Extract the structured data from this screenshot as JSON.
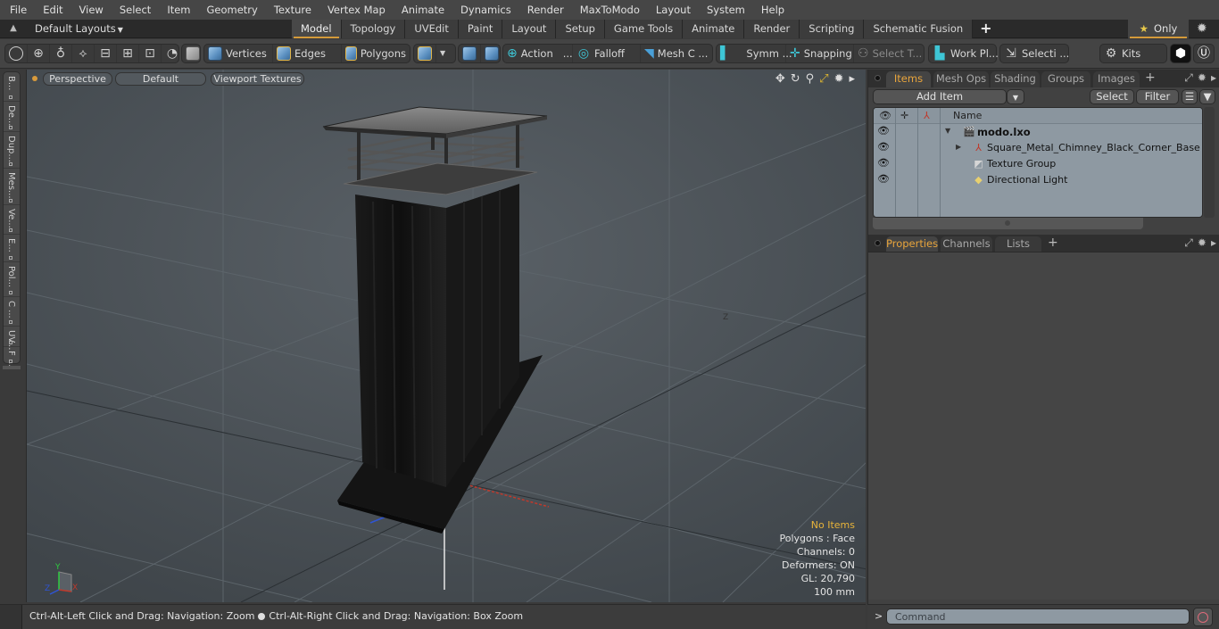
{
  "menu": [
    "File",
    "Edit",
    "View",
    "Select",
    "Item",
    "Geometry",
    "Texture",
    "Vertex Map",
    "Animate",
    "Dynamics",
    "Render",
    "MaxToModo",
    "Layout",
    "System",
    "Help"
  ],
  "layout_bar": {
    "layouts_label": "Default Layouts",
    "tabs": [
      "Model",
      "Topology",
      "UVEdit",
      "Paint",
      "Layout",
      "Setup",
      "Game Tools",
      "Animate",
      "Render",
      "Scripting",
      "Schematic Fusion"
    ],
    "active_tab": "Model",
    "add_label": "+",
    "only_label": "Only"
  },
  "toolbar": {
    "vertices": "Vertices",
    "edges": "Edges",
    "polygons": "Polygons",
    "action": "Action",
    "action_more": "...",
    "falloff": "Falloff",
    "mesh": "Mesh C ...",
    "symmetry": "Symm ...",
    "snapping": "Snapping",
    "select_tool": "Select T...",
    "work_plane": "Work Pl...",
    "selection": "Selecti ...",
    "kits": "Kits"
  },
  "side_tabs": [
    "B...",
    "De...",
    "Dup...",
    "Mes...",
    "Ve...",
    "E...",
    "Pol...",
    "C ...",
    "UV...",
    "F ..."
  ],
  "viewport": {
    "view_mode": "Perspective",
    "shading": "Default",
    "textures": "Viewport Textures",
    "info": {
      "selection": "No Items",
      "polygons": "Polygons : Face",
      "channels": "Channels: 0",
      "deformers": "Deformers: ON",
      "gl": "GL: 20,790",
      "scale": "100 mm"
    },
    "axis_labels": {
      "x": "X",
      "y": "Y",
      "z": "Z"
    }
  },
  "status": {
    "hint_left": "Ctrl-Alt-Left Click and Drag: Navigation: Zoom",
    "hint_right": "Ctrl-Alt-Right Click and Drag: Navigation: Box Zoom"
  },
  "items_panel": {
    "tabs": [
      "Items",
      "Mesh Ops",
      "Shading",
      "Groups",
      "Images"
    ],
    "active_tab": "Items",
    "add_item": "Add Item",
    "select": "Select",
    "filter": "Filter",
    "name_header": "Name",
    "tree": [
      {
        "label": "modo.lxo",
        "icon": "scene-icon",
        "depth": 0,
        "expanded": true
      },
      {
        "label": "Square_Metal_Chimney_Black_Corner_Base",
        "icon": "mesh-locator-icon",
        "depth": 1,
        "expanded": false
      },
      {
        "label": "Texture Group",
        "icon": "texture-group-icon",
        "depth": 1
      },
      {
        "label": "Directional Light",
        "icon": "directional-light-icon",
        "depth": 1
      }
    ]
  },
  "properties_panel": {
    "tabs": [
      "Properties",
      "Channels",
      "Lists"
    ],
    "active_tab": "Properties"
  },
  "command": {
    "prompt": ">",
    "placeholder": "Command"
  },
  "colors": {
    "accent": "#d49a3a",
    "active_tab_text": "#e9a53c",
    "viewport_bg": "#4b5258",
    "tree_bg": "#8e99a2",
    "axis_x": "#c0392b",
    "axis_y": "#2ecc40",
    "axis_z": "#2f55d4"
  }
}
